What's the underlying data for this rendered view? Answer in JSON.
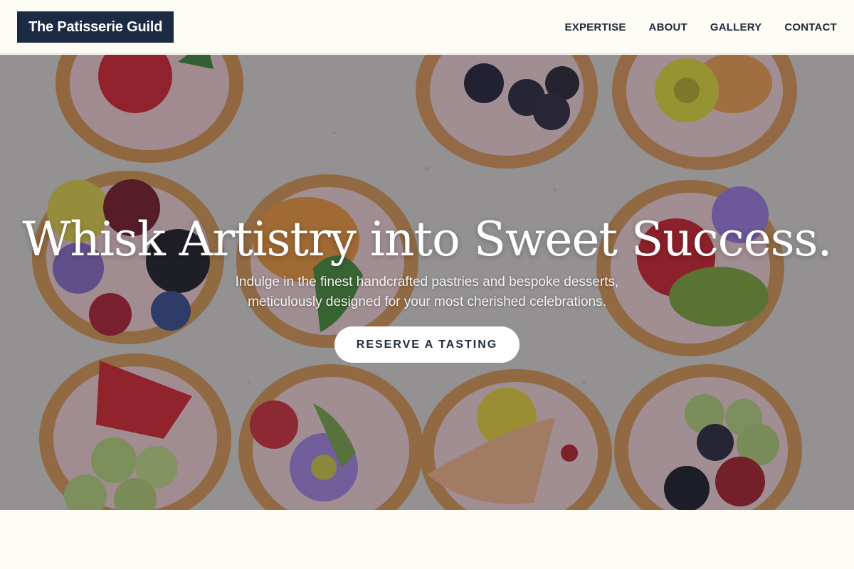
{
  "brand": {
    "name": "The Patisserie Guild",
    "color": "#1c2a44"
  },
  "nav": {
    "items": [
      {
        "label": "EXPERTISE"
      },
      {
        "label": "ABOUT"
      },
      {
        "label": "GALLERY"
      },
      {
        "label": "CONTACT"
      }
    ]
  },
  "hero": {
    "title": "Whisk Artistry into Sweet Success.",
    "subtitle_line1": "Indulge in the finest handcrafted pastries and bespoke desserts,",
    "subtitle_line2": "meticulously designed for your most cherished celebrations.",
    "cta_label": "RESERVE A TASTING",
    "background_image": "fruit tarts with cream, berries, kiwi and edible flowers on light surface"
  },
  "colors": {
    "page_bg": "#fdfcf5",
    "nav_text": "#1f2a3c",
    "overlay": "rgba(28,30,40,0.38)"
  }
}
